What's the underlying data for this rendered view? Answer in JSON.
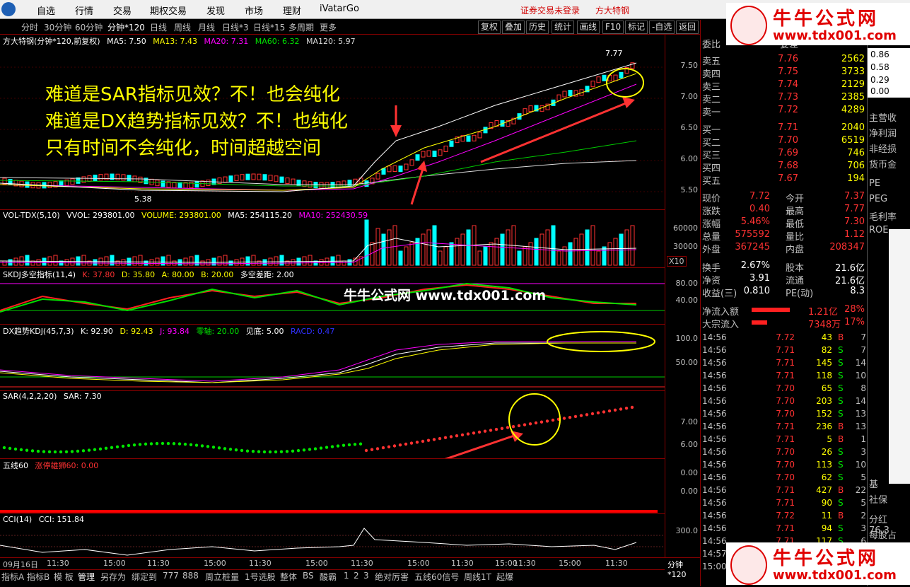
{
  "menu": {
    "items": [
      "自选",
      "行情",
      "交易",
      "期权交易",
      "发现",
      "市场",
      "理财",
      "iVatarGo"
    ],
    "warn1": "证券交易未登录",
    "warn2": "方大特钢"
  },
  "toolbar": {
    "periods": [
      "分时",
      "30分钟",
      "60分钟",
      "分钟*120",
      "日线",
      "周线",
      "月线",
      "日线*3",
      "日线*15",
      "多周期",
      "更多"
    ],
    "right_buttons": [
      "复权",
      "叠加",
      "历史",
      "统计",
      "画线",
      "F10",
      "标记",
      "-自选",
      "返回"
    ]
  },
  "main": {
    "title": "方大特钢(分钟*120,前复权)",
    "ma5": "MA5: 7.50",
    "ma13": "MA13: 7.43",
    "ma20": "MA20: 7.31",
    "ma60": "MA60: 6.32",
    "ma120": "MA120: 5.97",
    "high_label": "7.77",
    "low_label": "5.38",
    "yticks": [
      "7.50",
      "7.00",
      "6.50",
      "6.00",
      "5.50"
    ],
    "annotations": [
      "难道是SAR指标见效？不！也会纯化",
      "难道是DX趋势指标见效？不！也纯化",
      "只有时间不会纯化，时间超越空间"
    ]
  },
  "vol": {
    "title": "VOL-TDX(5,10)",
    "vvol": "VVOL: 293801.00",
    "volume": "VOLUME: 293801.00",
    "ma5": "MA5: 254115.20",
    "ma10": "MA10: 252430.59",
    "yticks": [
      "60000",
      "30000"
    ],
    "unit": "X10"
  },
  "skdj": {
    "title": "SKDJ多空指标(11,4)",
    "k": "K: 37.80",
    "d": "D: 35.80",
    "a": "A: 80.00",
    "b": "B: 20.00",
    "diff": "多空差距: 2.00",
    "yticks": [
      "80.00",
      "40.00"
    ],
    "watermark": "牛牛公式网 www.tdx001.com"
  },
  "dx": {
    "title": "DX趋势KDJ(45,7,3)",
    "k": "K: 92.90",
    "d": "D: 92.43",
    "j": "J: 93.84",
    "zero": "零轴: 20.00",
    "bottom": "见底: 5.00",
    "racd": "RACD: 0.47",
    "yticks": [
      "100.0",
      "50.00"
    ]
  },
  "sar": {
    "title": "SAR(4,2,2,20)",
    "sar": "SAR: 7.30",
    "yticks": [
      "7.00",
      "6.00"
    ]
  },
  "five": {
    "title": "五线60",
    "lion": "涨停雄狮60: 0.00",
    "yticks": [
      "0.00",
      "0.00"
    ]
  },
  "cci": {
    "title": "CCI(14)",
    "cci": "CCI: 151.84",
    "yticks": [
      "300.0"
    ]
  },
  "xaxis": {
    "labels": [
      "09月16日",
      "11:30",
      "15:00",
      "11:30",
      "15:00",
      "11:30",
      "15:00",
      "11:30",
      "15:00",
      "11:30",
      "15:00",
      "11:30",
      "15:00",
      "11:30",
      "15:00",
      "11:30",
      "15:00"
    ],
    "period_tag": "分钟*120"
  },
  "bottom": {
    "tabs": [
      "指标A",
      "指标B",
      "模 板",
      "管理",
      "另存为",
      "绑定到",
      "777",
      "888",
      "周立桩量",
      "1号选股",
      "整体",
      "BS",
      "酸霸",
      "1",
      "2",
      "3",
      "绝对厉害",
      "五线60信号",
      "周线1T",
      "起爆"
    ]
  },
  "quote": {
    "top_label": "委比",
    "top_right": "委差",
    "sells": [
      {
        "label": "卖五",
        "price": "7.76",
        "vol": "2562"
      },
      {
        "label": "卖四",
        "price": "7.75",
        "vol": "3733"
      },
      {
        "label": "卖三",
        "price": "7.74",
        "vol": "2129"
      },
      {
        "label": "卖二",
        "price": "7.73",
        "vol": "2385"
      },
      {
        "label": "卖一",
        "price": "7.72",
        "vol": "4289"
      }
    ],
    "buys": [
      {
        "label": "买一",
        "price": "7.71",
        "vol": "2040"
      },
      {
        "label": "买二",
        "price": "7.70",
        "vol": "6519"
      },
      {
        "label": "买三",
        "price": "7.69",
        "vol": "746"
      },
      {
        "label": "买四",
        "price": "7.68",
        "vol": "706"
      },
      {
        "label": "买五",
        "price": "7.67",
        "vol": "194"
      }
    ],
    "stats": [
      {
        "l1": "现价",
        "v1": "7.72",
        "l2": "今开",
        "v2": "7.37"
      },
      {
        "l1": "涨跌",
        "v1": "0.40",
        "l2": "最高",
        "v2": "7.77"
      },
      {
        "l1": "涨幅",
        "v1": "5.46%",
        "l2": "最低",
        "v2": "7.30"
      },
      {
        "l1": "总量",
        "v1": "575592",
        "l2": "量比",
        "v2": "1.12"
      },
      {
        "l1": "外盘",
        "v1": "367245",
        "l2": "内盘",
        "v2": "208347"
      }
    ],
    "stats2": [
      {
        "l1": "换手",
        "v1": "2.67%",
        "l2": "股本",
        "v2": "21.6亿"
      },
      {
        "l1": "净资",
        "v1": "3.91",
        "l2": "流通",
        "v2": "21.6亿"
      },
      {
        "l1": "收益(三)",
        "v1": "0.810",
        "l2": "PE(动)",
        "v2": "8.3"
      }
    ],
    "flow": [
      {
        "label": "净流入额",
        "value": "1.21亿",
        "pct": "28%"
      },
      {
        "label": "大宗流入",
        "value": "7348万",
        "pct": "17%"
      }
    ],
    "ticks": [
      {
        "t": "14:56",
        "p": "7.72",
        "v": "43",
        "f": "B",
        "n": "7"
      },
      {
        "t": "14:56",
        "p": "7.71",
        "v": "82",
        "f": "S",
        "n": "7"
      },
      {
        "t": "14:56",
        "p": "7.71",
        "v": "145",
        "f": "S",
        "n": "14"
      },
      {
        "t": "14:56",
        "p": "7.71",
        "v": "118",
        "f": "S",
        "n": "10"
      },
      {
        "t": "14:56",
        "p": "7.70",
        "v": "65",
        "f": "S",
        "n": "8"
      },
      {
        "t": "14:56",
        "p": "7.70",
        "v": "203",
        "f": "S",
        "n": "14"
      },
      {
        "t": "14:56",
        "p": "7.70",
        "v": "152",
        "f": "S",
        "n": "13"
      },
      {
        "t": "14:56",
        "p": "7.71",
        "v": "236",
        "f": "B",
        "n": "13"
      },
      {
        "t": "14:56",
        "p": "7.71",
        "v": "5",
        "f": "B",
        "n": "1"
      },
      {
        "t": "14:56",
        "p": "7.70",
        "v": "26",
        "f": "S",
        "n": "3"
      },
      {
        "t": "14:56",
        "p": "7.70",
        "v": "113",
        "f": "S",
        "n": "10"
      },
      {
        "t": "14:56",
        "p": "7.70",
        "v": "62",
        "f": "S",
        "n": "5"
      },
      {
        "t": "14:56",
        "p": "7.71",
        "v": "427",
        "f": "B",
        "n": "22"
      },
      {
        "t": "14:56",
        "p": "7.71",
        "v": "90",
        "f": "S",
        "n": "5"
      },
      {
        "t": "14:56",
        "p": "7.72",
        "v": "11",
        "f": "B",
        "n": "2"
      },
      {
        "t": "14:56",
        "p": "7.71",
        "v": "94",
        "f": "S",
        "n": "3"
      },
      {
        "t": "14:56",
        "p": "7.71",
        "v": "117",
        "f": "S",
        "n": "6"
      },
      {
        "t": "14:57",
        "p": "7.71",
        "v": "",
        "f": "",
        "n": ""
      },
      {
        "t": "15:00",
        "p": "7.72",
        "v": "",
        "f": "",
        "n": ""
      }
    ]
  },
  "farright": {
    "ratios": [
      "0.86",
      "0.58",
      "0.29",
      "0.00"
    ],
    "labels": [
      "主营收",
      "净利润",
      "非经损",
      "货币金",
      "PE",
      "PEG",
      "毛利率",
      "ROE"
    ],
    "lower": [
      "分红 76.3",
      "每股占"
    ],
    "base": [
      "基",
      "社保"
    ]
  },
  "watermark": {
    "brand": "牛牛公式网",
    "url": "www.tdx001.com"
  }
}
